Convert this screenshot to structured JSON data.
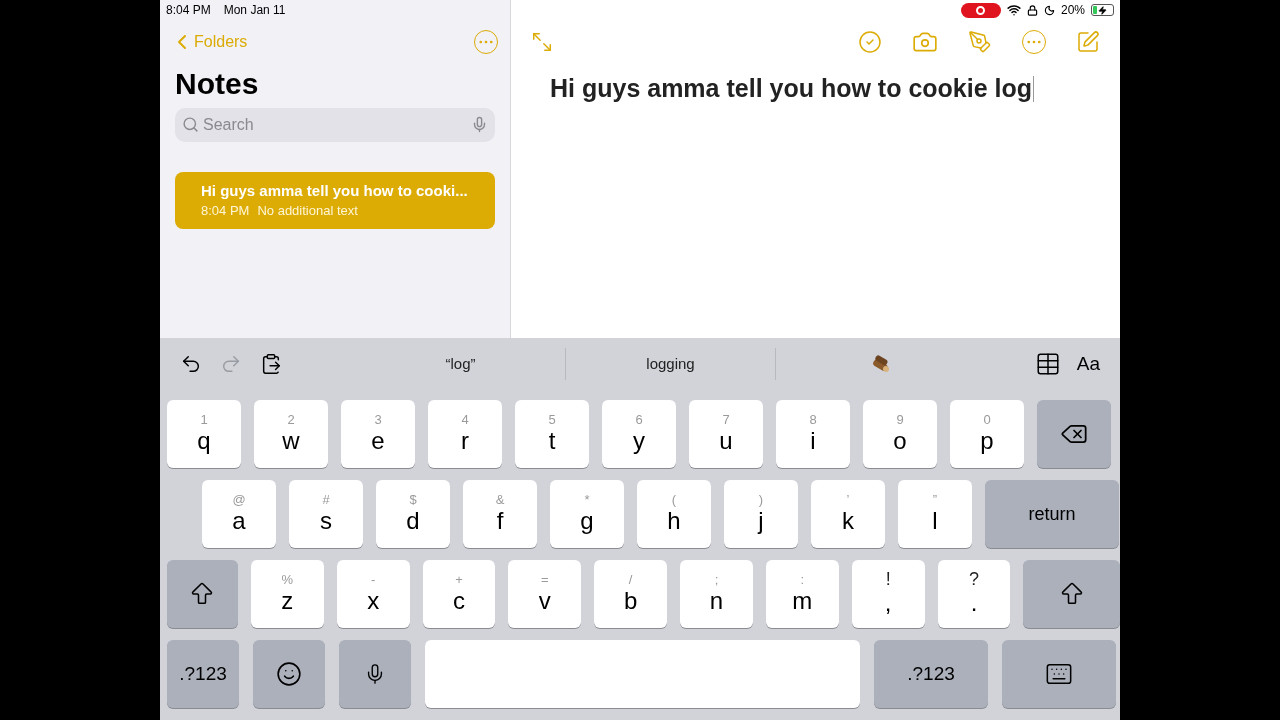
{
  "status_bar": {
    "time": "8:04 PM",
    "date": "Mon Jan 11",
    "recording": true,
    "battery": "20%"
  },
  "sidebar": {
    "back": "Folders",
    "title": "Notes",
    "search": {
      "placeholder": "Search"
    },
    "notes": [
      {
        "title": "Hi guys amma tell you how to cooki...",
        "time": "8:04 PM",
        "preview": "No additional text",
        "selected": true
      }
    ]
  },
  "editor": {
    "text": "Hi guys amma tell you how to cookie log"
  },
  "keyboard": {
    "format_label": "Aa",
    "undo_enabled": true,
    "redo_enabled": false,
    "suggestions": [
      "“log”",
      "logging"
    ],
    "rows": [
      [
        {
          "kind": "letter",
          "hint": "1",
          "label": "q"
        },
        {
          "kind": "letter",
          "hint": "2",
          "label": "w"
        },
        {
          "kind": "letter",
          "hint": "3",
          "label": "e"
        },
        {
          "kind": "letter",
          "hint": "4",
          "label": "r"
        },
        {
          "kind": "letter",
          "hint": "5",
          "label": "t"
        },
        {
          "kind": "letter",
          "hint": "6",
          "label": "y"
        },
        {
          "kind": "letter",
          "hint": "7",
          "label": "u"
        },
        {
          "kind": "letter",
          "hint": "8",
          "label": "i"
        },
        {
          "kind": "letter",
          "hint": "9",
          "label": "o"
        },
        {
          "kind": "letter",
          "hint": "0",
          "label": "p"
        },
        {
          "kind": "delete"
        }
      ],
      [
        {
          "kind": "letter",
          "hint": "@",
          "label": "a"
        },
        {
          "kind": "letter",
          "hint": "#",
          "label": "s"
        },
        {
          "kind": "letter",
          "hint": "$",
          "label": "d"
        },
        {
          "kind": "letter",
          "hint": "&",
          "label": "f"
        },
        {
          "kind": "letter",
          "hint": "*",
          "label": "g"
        },
        {
          "kind": "letter",
          "hint": "(",
          "label": "h"
        },
        {
          "kind": "letter",
          "hint": ")",
          "label": "j"
        },
        {
          "kind": "letter",
          "hint": "’",
          "label": "k"
        },
        {
          "kind": "letter",
          "hint": "”",
          "label": "l"
        },
        {
          "kind": "return",
          "label": "return"
        }
      ],
      [
        {
          "kind": "shift"
        },
        {
          "kind": "letter",
          "hint": "%",
          "label": "z"
        },
        {
          "kind": "letter",
          "hint": "-",
          "label": "x"
        },
        {
          "kind": "letter",
          "hint": "+",
          "label": "c"
        },
        {
          "kind": "letter",
          "hint": "=",
          "label": "v"
        },
        {
          "kind": "letter",
          "hint": "/",
          "label": "b"
        },
        {
          "kind": "letter",
          "hint": ";",
          "label": "n"
        },
        {
          "kind": "letter",
          "hint": ":",
          "label": "m"
        },
        {
          "kind": "punct",
          "hint": "!",
          "label": ","
        },
        {
          "kind": "punct",
          "hint": "?",
          "label": "."
        },
        {
          "kind": "shift_wide"
        }
      ],
      [
        {
          "kind": "numbers",
          "label": ".?123"
        },
        {
          "kind": "emoji"
        },
        {
          "kind": "mic"
        },
        {
          "kind": "space"
        },
        {
          "kind": "numbers_wide",
          "label": ".?123"
        },
        {
          "kind": "hide"
        }
      ]
    ]
  }
}
